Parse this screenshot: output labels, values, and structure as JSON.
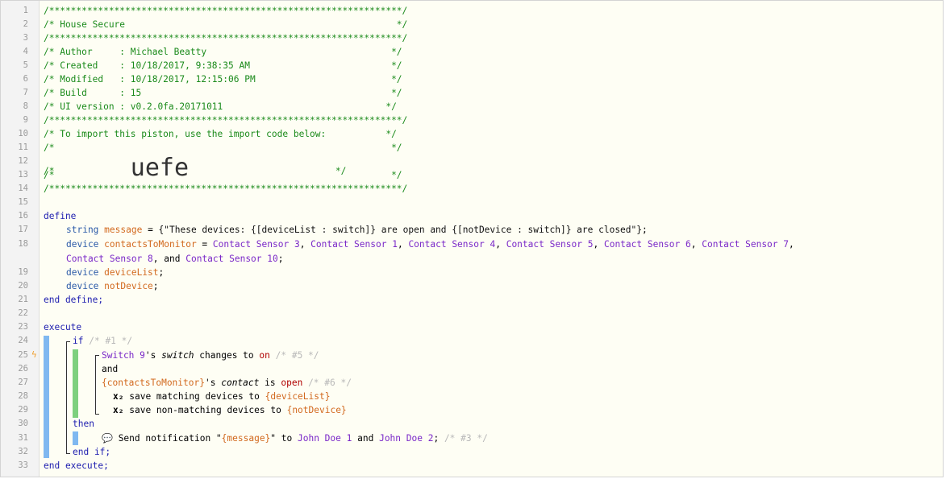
{
  "gutter": {
    "line_numbers": [
      "1",
      "2",
      "3",
      "4",
      "5",
      "6",
      "7",
      "8",
      "9",
      "10",
      "11",
      "12",
      "13",
      "14",
      "15",
      "16",
      "17",
      "18",
      "",
      "19",
      "20",
      "21",
      "22",
      "23",
      "24",
      "25",
      "26",
      "27",
      "28",
      "29",
      "30",
      "31",
      "32",
      "33"
    ]
  },
  "header": {
    "stars_open": "/*****************************************************************/",
    "title": "/* House Secure                                                  */",
    "stars_mid": "/*****************************************************************/",
    "author": "/* Author     : Michael Beatty                                  */",
    "created": "/* Created    : 10/18/2017, 9:38:35 AM                          */",
    "modified": "/* Modified   : 10/18/2017, 12:15:06 PM                         */",
    "build": "/* Build      : 15                                              */",
    "ui_version": "/* UI version : v0.2.0fa.20171011                              */",
    "stars_mid2": "/*****************************************************************/",
    "import_note": "/* To import this piston, use the import code below:           */",
    "blank_a": "/*                                                              */",
    "blank_b_start": "/*              ",
    "import_code": "uefe",
    "blank_b_end": "                           */",
    "blank_c": "/*                                                              */",
    "stars_close": "/*****************************************************************/"
  },
  "define_block": {
    "kw_define": "define",
    "message_type": "string",
    "message_name": "message",
    "message_value": "{\"These devices: {[deviceList : switch]} are open and {[notDevice : switch]} are closed\"}",
    "contacts_type": "device",
    "contacts_name": "contactsToMonitor",
    "contacts_devices": [
      "Contact Sensor 3",
      "Contact Sensor 1",
      "Contact Sensor 4",
      "Contact Sensor 5",
      "Contact Sensor 6",
      "Contact Sensor 7",
      "Contact Sensor 8",
      "Contact Sensor 10"
    ],
    "and_word": "and",
    "devlist_type": "device",
    "devlist_name": "deviceList",
    "notdev_type": "device",
    "notdev_name": "notDevice",
    "end_define": "end define;"
  },
  "execute_block": {
    "kw_execute": "execute",
    "kw_if": "if",
    "if_comment": "/* #1 */",
    "switch_device": "Switch 9",
    "switch_possessive": "'s",
    "switch_attr": "switch",
    "switch_changes": "changes to",
    "switch_value": "on",
    "cond1_comment": "/* #5 */",
    "and_op": "and",
    "contacts_var": "{contactsToMonitor}",
    "contact_possessive": "'s",
    "contact_attr": "contact",
    "contact_is": "is",
    "contact_value": "open",
    "cond2_comment": "/* #6 */",
    "sub_icon": "x₂",
    "save_matching": "save matching devices to",
    "save_matching_target": "{deviceList}",
    "save_nonmatching": "save non-matching devices to",
    "save_nonmatching_target": "{notDevice}",
    "kw_then": "then",
    "notify_icon": "💬",
    "notify_text": "Send notification \"",
    "notify_var": "{message}",
    "notify_to": "\" to",
    "contact1": "John Doe 1",
    "notify_and": "and",
    "contact2": "John Doe 2",
    "notify_semicolon": ";",
    "notify_comment": "/* #3 */",
    "end_if": "end if;",
    "end_execute": "end execute;"
  },
  "colors": {
    "comment": "#1a8a1a",
    "keyword": "#2020b0",
    "variable": "#d2691e",
    "device": "#7a28c8",
    "background": "#fefef4",
    "gutter": "#f3f3f3",
    "if_bar": "#7fb8f0",
    "condition_bar": "#7ed07e",
    "trigger_bolt": "#f0a030"
  }
}
